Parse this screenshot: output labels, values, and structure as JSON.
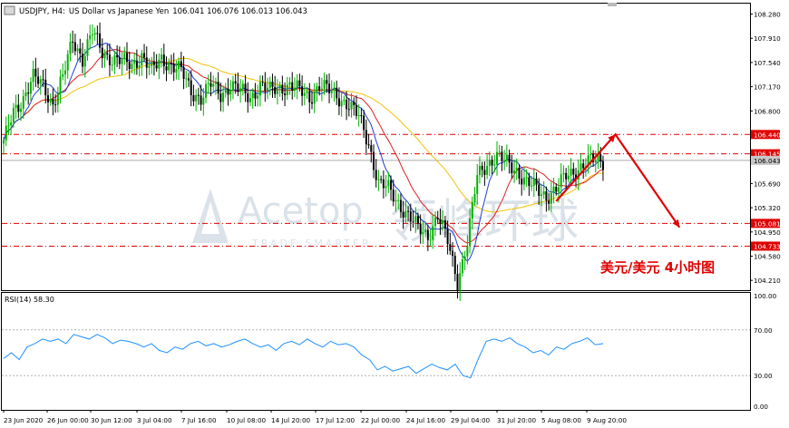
{
  "header": {
    "symbol": "USDJPY, H4:",
    "description": "US Dollar vs Japanese Yen",
    "ohlc": "106.041 106.076 106.013 106.043"
  },
  "annotation": "美元/美元  4小时图",
  "watermark": {
    "brand": "Acetop",
    "brand_cn": "领峰环球",
    "tagline": "TRADE SMARTER"
  },
  "colors": {
    "bull": "#00b000",
    "bear": "#000000",
    "ma_fast": "#1f3fd0",
    "ma_mid": "#e02020",
    "ma_slow": "#f2c200",
    "level_line": "#e00000",
    "arrow": "#e00000",
    "rsi": "#1e90ff"
  },
  "chart_data": {
    "type": "candlestick",
    "symbol": "USDJPY",
    "timeframe": "H4",
    "y_ticks": [
      "108.280",
      "107.910",
      "107.540",
      "107.170",
      "106.800",
      "105.690",
      "105.320",
      "104.950",
      "104.580",
      "104.210"
    ],
    "x_ticks": [
      "23 Jun 2020",
      "26 Jun 00:00",
      "30 Jun 12:00",
      "3 Jul 04:00",
      "7 Jul 16:00",
      "10 Jul 08:00",
      "14 Jul 20:00",
      "17 Jul 12:00",
      "22 Jul 00:00",
      "24 Jul 16:00",
      "29 Jul 04:00",
      "31 Jul 20:00",
      "5 Aug 08:00",
      "9 Aug 20:00"
    ],
    "price_labels": [
      {
        "value": 106.44,
        "label": "106.440"
      },
      {
        "value": 106.145,
        "label": "106.145"
      },
      {
        "value": 106.043,
        "label": "106.043"
      },
      {
        "value": 105.081,
        "label": "105.081"
      },
      {
        "value": 104.733,
        "label": "104.733"
      }
    ],
    "horizontal_levels": [
      106.44,
      106.145,
      105.081,
      104.733
    ],
    "ylim": [
      104.06,
      108.44
    ],
    "close_path": [
      [
        0,
        106.3
      ],
      [
        4,
        106.8
      ],
      [
        8,
        107.0
      ],
      [
        12,
        107.3
      ],
      [
        16,
        107.2
      ],
      [
        20,
        106.9
      ],
      [
        24,
        107.3
      ],
      [
        28,
        107.9
      ],
      [
        32,
        107.6
      ],
      [
        36,
        108.0
      ],
      [
        40,
        107.7
      ],
      [
        44,
        107.6
      ],
      [
        48,
        107.55
      ],
      [
        52,
        107.5
      ],
      [
        56,
        107.65
      ],
      [
        60,
        107.4
      ],
      [
        64,
        107.6
      ],
      [
        68,
        107.5
      ],
      [
        72,
        107.4
      ],
      [
        76,
        107.1
      ],
      [
        80,
        107.0
      ],
      [
        84,
        107.2
      ],
      [
        88,
        107.05
      ],
      [
        92,
        107.2
      ],
      [
        96,
        107.1
      ],
      [
        100,
        107.0
      ],
      [
        104,
        107.2
      ],
      [
        108,
        107.1
      ],
      [
        112,
        107.15
      ],
      [
        116,
        107.2
      ],
      [
        120,
        107.1
      ],
      [
        124,
        107.0
      ],
      [
        128,
        107.2
      ],
      [
        132,
        107.1
      ],
      [
        136,
        107.0
      ],
      [
        140,
        106.9
      ],
      [
        144,
        106.7
      ],
      [
        148,
        106.3
      ],
      [
        152,
        105.7
      ],
      [
        156,
        105.6
      ],
      [
        160,
        105.4
      ],
      [
        164,
        105.2
      ],
      [
        168,
        105.0
      ],
      [
        172,
        104.9
      ],
      [
        176,
        105.2
      ],
      [
        180,
        104.8
      ],
      [
        184,
        104.2
      ],
      [
        188,
        104.8
      ],
      [
        192,
        105.8
      ],
      [
        196,
        106.0
      ],
      [
        200,
        106.1
      ],
      [
        204,
        106.0
      ],
      [
        208,
        105.9
      ],
      [
        212,
        105.7
      ],
      [
        216,
        105.6
      ],
      [
        220,
        105.5
      ],
      [
        224,
        105.6
      ],
      [
        228,
        105.8
      ],
      [
        232,
        105.9
      ],
      [
        236,
        106.0
      ],
      [
        240,
        106.05
      ],
      [
        243,
        106.04
      ]
    ],
    "forecast_path": [
      [
        224,
        105.42
      ],
      [
        248,
        106.44
      ],
      [
        274,
        105.02
      ]
    ],
    "rsi": {
      "label": "RSI(14) 58.30",
      "value": 58.3,
      "levels": [
        70,
        30
      ],
      "y_ticks": [
        "100.00",
        "70.00",
        "30.00",
        "0.00"
      ],
      "values": [
        45,
        50,
        44,
        55,
        58,
        62,
        60,
        62,
        58,
        66,
        64,
        62,
        66,
        63,
        58,
        61,
        60,
        58,
        55,
        58,
        52,
        50,
        55,
        53,
        58,
        60,
        56,
        58,
        55,
        57,
        60,
        62,
        58,
        55,
        57,
        52,
        58,
        60,
        57,
        62,
        58,
        55,
        60,
        57,
        58,
        55,
        48,
        44,
        35,
        38,
        34,
        36,
        38,
        32,
        36,
        40,
        37,
        35,
        40,
        30,
        28,
        45,
        60,
        62,
        60,
        63,
        58,
        55,
        50,
        52,
        48,
        55,
        53,
        58,
        60,
        63,
        57,
        58
      ]
    }
  }
}
